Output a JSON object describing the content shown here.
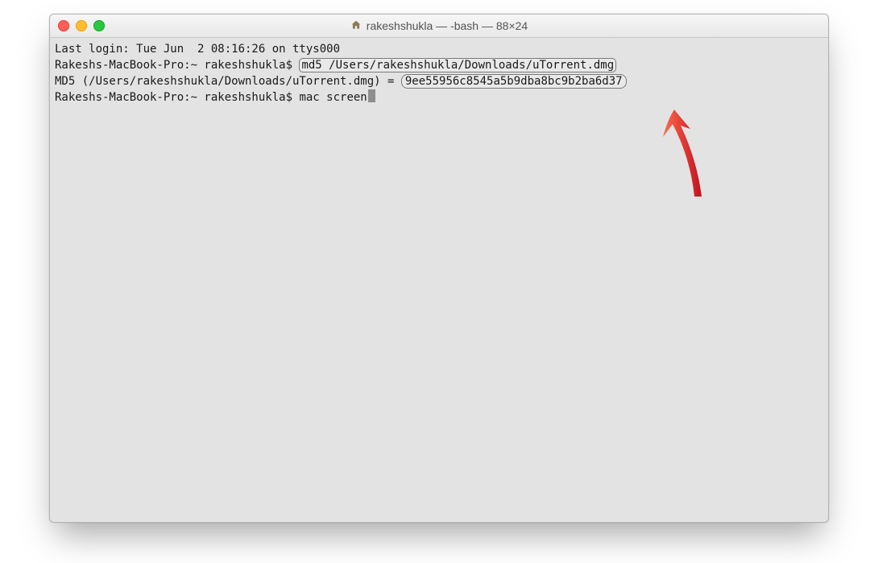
{
  "window": {
    "title": "rakeshshukla — -bash — 88×24"
  },
  "terminal": {
    "line1": "Last login: Tue Jun  2 08:16:26 on ttys000",
    "prompt1": "Rakeshs-MacBook-Pro:~ rakeshshukla$ ",
    "cmd1": "md5 /Users/rakeshshukla/Downloads/uTorrent.dmg",
    "out_prefix": "MD5 (/Users/rakeshshukla/Downloads/uTorrent.dmg) = ",
    "hash": "9ee55956c8545a5b9dba8bc9b2ba6d37",
    "prompt2": "Rakeshs-MacBook-Pro:~ rakeshshukla$ ",
    "cmd2": "mac screen"
  }
}
